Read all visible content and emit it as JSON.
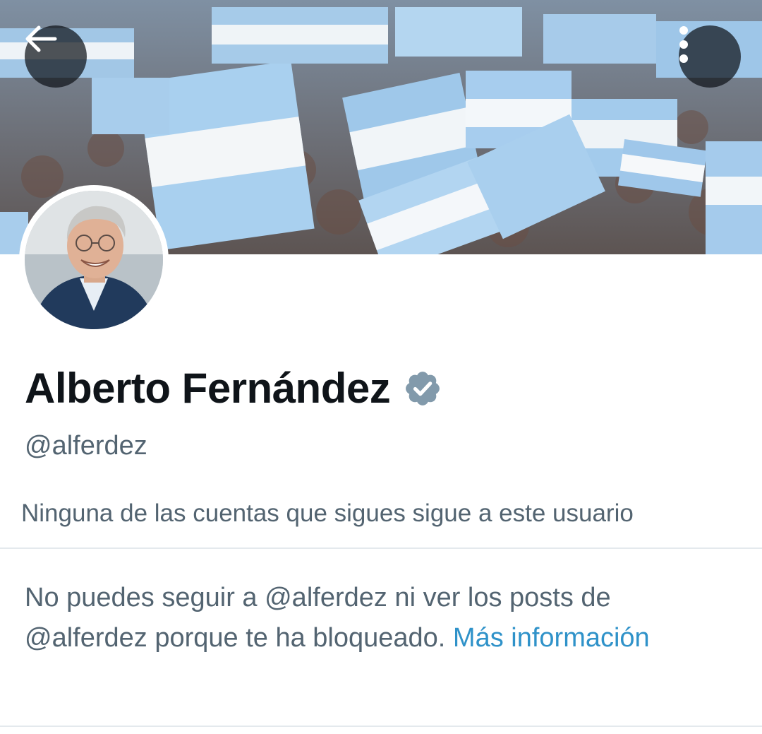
{
  "header": {
    "back_icon": "arrow-left-icon",
    "more_icon": "more-vertical-icon",
    "colors": {
      "button_bg": "#0f1419",
      "banner_flag_light": "#a8cdec",
      "banner_flag_white": "#f4f7fa"
    }
  },
  "profile": {
    "display_name": "Alberto Fernández",
    "verified_icon": "verified-badge-icon",
    "handle": "@alferdez",
    "followers_you_know": "Ninguna de las cuentas que sigues sigue a este usuario"
  },
  "blocked_notice": {
    "line": "No puedes seguir a @alferdez ni ver los posts de @alferdez porque te ha bloqueado.",
    "link_label": "Más información"
  },
  "colors": {
    "primary_text": "#0f1419",
    "secondary_text": "#536471",
    "link": "#2f92c9",
    "divider": "#e4e9ed"
  }
}
